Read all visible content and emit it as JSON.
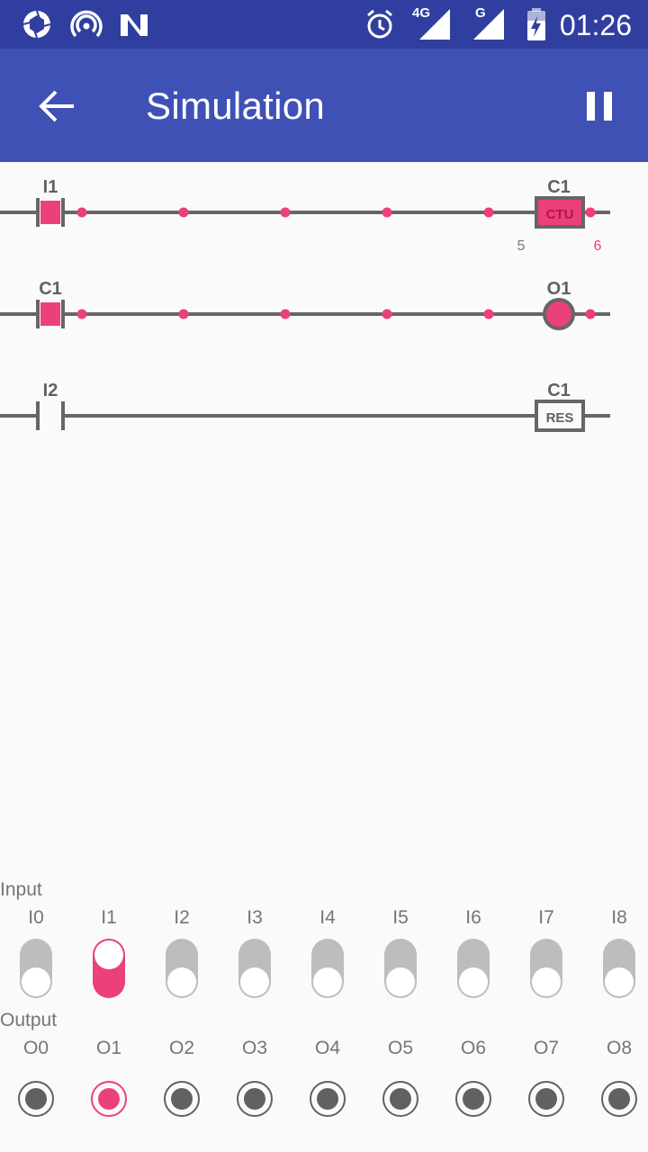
{
  "status_bar": {
    "time": "01:26",
    "network_4g": "4G",
    "network_g": "G",
    "icons": [
      "aperture-icon",
      "hotspot-icon",
      "n-icon",
      "alarm-icon",
      "signal-icon",
      "signal-icon",
      "battery-charging-icon"
    ]
  },
  "app_bar": {
    "title": "Simulation",
    "back_icon": "arrow-back-icon",
    "pause_icon": "pause-icon"
  },
  "ladder": {
    "rungs": [
      {
        "contact_label": "I1",
        "contact_active": true,
        "coil_label": "C1",
        "coil_type": "counter",
        "coil_text": "CTU",
        "coil_active": true,
        "preset": "5",
        "count": "6"
      },
      {
        "contact_label": "C1",
        "contact_active": true,
        "coil_label": "O1",
        "coil_type": "output",
        "coil_active": true
      },
      {
        "contact_label": "I2",
        "contact_active": false,
        "coil_label": "C1",
        "coil_type": "reset",
        "coil_text": "RES",
        "coil_active": false
      }
    ]
  },
  "inputs": {
    "section_label": "Input",
    "items": [
      {
        "label": "I0",
        "on": false
      },
      {
        "label": "I1",
        "on": true
      },
      {
        "label": "I2",
        "on": false
      },
      {
        "label": "I3",
        "on": false
      },
      {
        "label": "I4",
        "on": false
      },
      {
        "label": "I5",
        "on": false
      },
      {
        "label": "I6",
        "on": false
      },
      {
        "label": "I7",
        "on": false
      },
      {
        "label": "I8",
        "on": false
      }
    ]
  },
  "outputs": {
    "section_label": "Output",
    "items": [
      {
        "label": "O0",
        "on": false
      },
      {
        "label": "O1",
        "on": true
      },
      {
        "label": "O2",
        "on": false
      },
      {
        "label": "O3",
        "on": false
      },
      {
        "label": "O4",
        "on": false
      },
      {
        "label": "O5",
        "on": false
      },
      {
        "label": "O6",
        "on": false
      },
      {
        "label": "O7",
        "on": false
      },
      {
        "label": "O8",
        "on": false
      }
    ]
  },
  "colors": {
    "primary": "#3f51b5",
    "primary_dark": "#303f9f",
    "accent": "#ec407a",
    "line": "#666666",
    "inactive": "#bdbdbd"
  }
}
